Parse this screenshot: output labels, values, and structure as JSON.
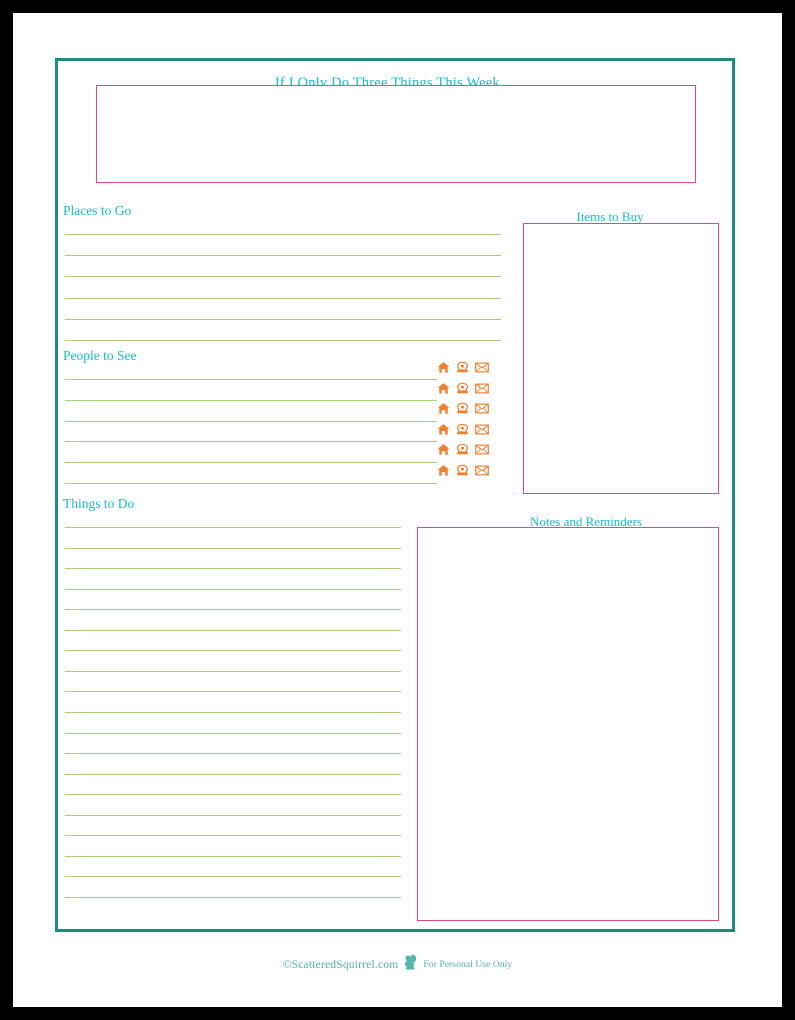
{
  "page": {
    "background_color": "#000000",
    "sheet_color": "#ffffff",
    "frame_color": "#1F8C7E",
    "accent_teal": "#15BDD2",
    "accent_pink": "#E2497E",
    "accent_green": "#9CC96B",
    "accent_orange": "#F08030",
    "footer_teal": "#4FB3A6"
  },
  "header": {
    "title": "If I Only Do Three Things This Week...."
  },
  "three_things_box": {
    "name": "three-things-box",
    "placeholder": ""
  },
  "sections": {
    "places_to_go": {
      "heading": "Places to Go",
      "line_count": 6
    },
    "people_to_see": {
      "heading": "People to See",
      "line_count": 6,
      "icons": [
        "home-icon",
        "phone-icon",
        "envelope-icon"
      ],
      "icon_row_count": 6
    },
    "things_to_do": {
      "heading": "Things to Do",
      "line_count": 19
    },
    "items_to_buy": {
      "heading": "Items to Buy"
    },
    "notes_and_reminders": {
      "heading": "Notes and Reminders"
    }
  },
  "footer": {
    "credit": "©ScatteredSquirrel.com",
    "icon": "squirrel-icon",
    "usage": "For Personal Use Only"
  }
}
